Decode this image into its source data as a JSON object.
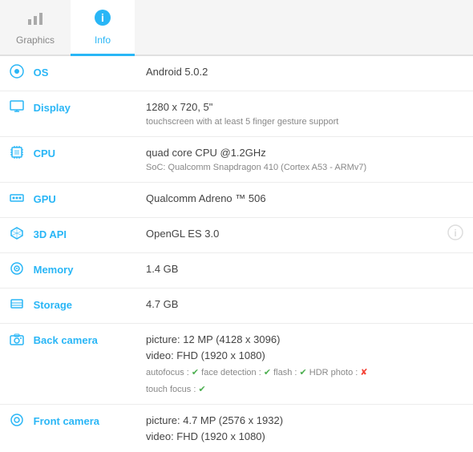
{
  "tabs": [
    {
      "id": "graphics",
      "label": "Graphics",
      "icon": "📊",
      "active": false
    },
    {
      "id": "info",
      "label": "Info",
      "icon": "ℹ️",
      "active": true
    }
  ],
  "rows": [
    {
      "id": "os",
      "label": "OS",
      "icon": "⚙",
      "value": "Android 5.0.2",
      "sub": ""
    },
    {
      "id": "display",
      "label": "Display",
      "icon": "🖥",
      "value": "1280 x 720, 5\"",
      "sub": "touchscreen with at least 5 finger gesture support"
    },
    {
      "id": "cpu",
      "label": "CPU",
      "icon": "🔲",
      "value": "quad core CPU @1.2GHz",
      "sub": "SoC: Qualcomm Snapdragon 410 (Cortex A53 - ARMv7)"
    },
    {
      "id": "gpu",
      "label": "GPU",
      "icon": "🎮",
      "value": "Qualcomm Adreno ™ 506",
      "sub": ""
    },
    {
      "id": "3dapi",
      "label": "3D API",
      "icon": "📦",
      "value": "OpenGL ES 3.0",
      "sub": "",
      "has_info": true
    },
    {
      "id": "memory",
      "label": "Memory",
      "icon": "💾",
      "value": "1.4 GB",
      "sub": ""
    },
    {
      "id": "storage",
      "label": "Storage",
      "icon": "📋",
      "value": "4.7 GB",
      "sub": ""
    },
    {
      "id": "back-camera",
      "label": "Back camera",
      "icon": "📷",
      "value_lines": [
        "picture: 12 MP (4128 x 3096)",
        "video: FHD (1920 x 1080)"
      ],
      "detail": "autofocus : ✔  face detection : ✔  flash : ✔  HDR photo : ✘",
      "detail2": "touch focus : ✔"
    },
    {
      "id": "front-camera",
      "label": "Front camera",
      "icon": "🔵",
      "value_lines": [
        "picture: 4.7 MP (2576 x 1932)",
        "video: FHD (1920 x 1080)"
      ],
      "detail": "",
      "detail2": ""
    }
  ],
  "back_camera": {
    "detail_parts": [
      {
        "text": "autofocus : ",
        "type": "label"
      },
      {
        "text": "✔",
        "type": "check"
      },
      {
        "text": "  face detection : ",
        "type": "label"
      },
      {
        "text": "✔",
        "type": "check"
      },
      {
        "text": "  flash : ",
        "type": "label"
      },
      {
        "text": "✔",
        "type": "check"
      },
      {
        "text": "  HDR photo : ",
        "type": "label"
      },
      {
        "text": "✘",
        "type": "cross"
      }
    ],
    "detail2": "touch focus : ✔"
  }
}
